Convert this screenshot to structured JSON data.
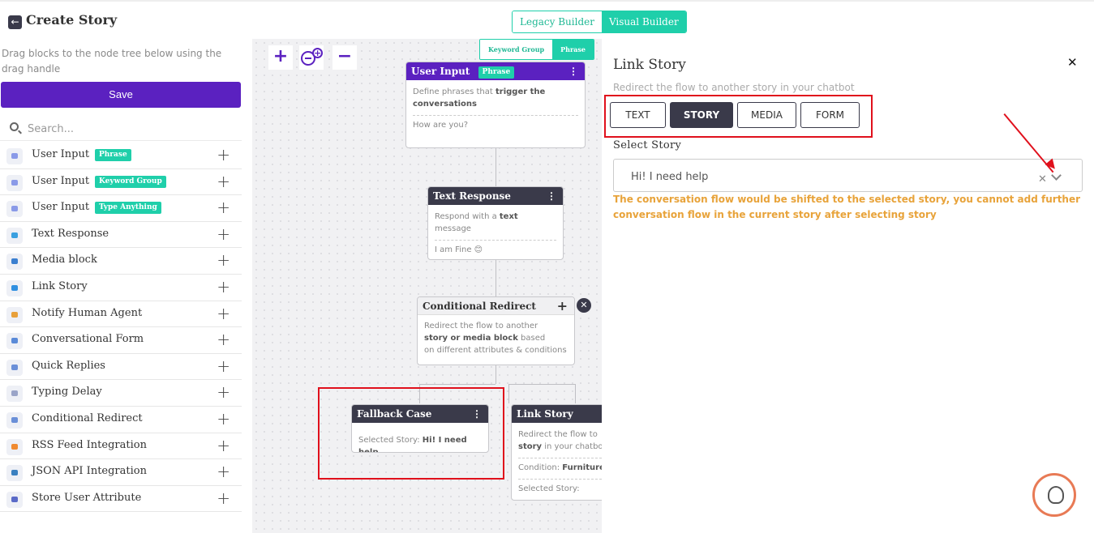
{
  "header": {
    "title": "Create Story",
    "builder_tabs": [
      "Legacy Builder",
      "Visual Builder"
    ]
  },
  "sidebar": {
    "hint": "Drag blocks to the node tree below using the drag handle",
    "save_label": "Save",
    "search_placeholder": "Search...",
    "blocks": [
      {
        "label": "User Input",
        "tag": "Phrase"
      },
      {
        "label": "User Input",
        "tag": "Keyword Group"
      },
      {
        "label": "User Input",
        "tag": "Type Anything"
      },
      {
        "label": "Text Response"
      },
      {
        "label": "Media block"
      },
      {
        "label": "Link Story"
      },
      {
        "label": "Notify Human Agent"
      },
      {
        "label": "Conversational Form"
      },
      {
        "label": "Quick Replies"
      },
      {
        "label": "Typing Delay"
      },
      {
        "label": "Conditional Redirect"
      },
      {
        "label": "RSS Feed Integration"
      },
      {
        "label": "JSON API Integration"
      },
      {
        "label": "Store User Attribute"
      }
    ]
  },
  "canvas": {
    "zoom_in": "+",
    "zoom_out": "−",
    "input_toggle": [
      "Keyword Group",
      "Phrase"
    ],
    "user_input_node": {
      "title": "User Input",
      "tag": "Phrase",
      "desc_pre": "Define phrases that ",
      "desc_bold": "trigger the conversations",
      "phrase": "How are you?"
    },
    "text_response_node": {
      "title": "Text Response",
      "desc_pre": "Respond with a ",
      "desc_bold": "text",
      "desc_post": " message",
      "message": "I am Fine 😊"
    },
    "conditional_node": {
      "title": "Conditional Redirect",
      "line1": "Redirect the flow to another",
      "line2_bold": "story or media block",
      "line2_post": " based",
      "line3": "on different attributes & conditions"
    },
    "fallback_node": {
      "title": "Fallback Case",
      "label": "Selected Story: ",
      "value": "Hi! I need help"
    },
    "link_story_node": {
      "title": "Link Story",
      "line1": "Redirect the flow to",
      "line2_bold": "story",
      "line2_post": " in your chatbo",
      "condition_label": "Condition: ",
      "condition_value": "Furniture",
      "selected_label": "Selected Story:"
    }
  },
  "panel": {
    "title": "Link Story",
    "subtitle": "Redirect the flow to another story in your chatbot",
    "tabs": [
      "TEXT",
      "STORY",
      "MEDIA",
      "FORM"
    ],
    "select_label": "Select Story",
    "select_value": "Hi! I need help",
    "warning": "The conversation flow would be shifted to the selected story, you cannot add further conversation flow in the current story after selecting story"
  },
  "colors": {
    "accent": "#5b21c0",
    "teal": "#1fcfaa",
    "dark_header": "#3a3a4a",
    "warning": "#e8a33a",
    "annotation": "#e0101c"
  }
}
